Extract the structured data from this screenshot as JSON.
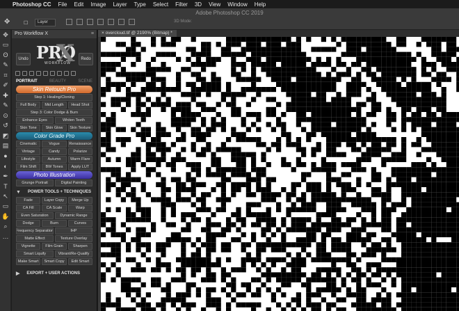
{
  "menubar": {
    "app": "Photoshop CC",
    "items": [
      "File",
      "Edit",
      "Image",
      "Layer",
      "Type",
      "Select",
      "Filter",
      "3D",
      "View",
      "Window",
      "Help"
    ]
  },
  "window": {
    "title": "Adobe Photoshop CC 2019"
  },
  "options": {
    "layer_select": "Layer",
    "mode_3d": "3D Mode:"
  },
  "panel": {
    "title": "Pro Workflow X",
    "undo": "Undo",
    "redo": "Redo",
    "logo_main": "PRO",
    "logo_x": "X",
    "logo_sub": "WORKFLOW",
    "tabs": [
      "PORTRAIT",
      "BEAUTY",
      "SCENE"
    ],
    "skin_header": "Skin Retouch Pro",
    "skin_rows": [
      [
        "Step 1: Healing/Cloning"
      ],
      [
        "Full Body",
        "Mid Length",
        "Head Shot"
      ],
      [
        "Step 3: Color Dodge & Burn"
      ],
      [
        "Enhance Eyes",
        "Whiten Teeth"
      ],
      [
        "Skin Tone",
        "Skin Glow",
        "Skin Texture"
      ]
    ],
    "color_header": "Color Grade Pro",
    "color_rows": [
      [
        "Cinematic",
        "Vogue",
        "Renaissance"
      ],
      [
        "Vintage",
        "Candy",
        "Polarize"
      ],
      [
        "Lifestyle",
        "Autumn",
        "Warm Flare"
      ],
      [
        "Film Shift",
        "BW Tones",
        "Apply LUT"
      ]
    ],
    "photo_header": "Photo Illustration",
    "photo_rows": [
      [
        "Grunge Portrait",
        "Digital Painting"
      ]
    ],
    "power_title": "POWER TOOLS + TECHNIQUES",
    "power_rows": [
      [
        "Fade",
        "Layer Copy",
        "Merge Up"
      ],
      [
        "CA Fill",
        "CA Scale",
        "Warp"
      ],
      [
        "Even Saturation",
        "Dynamic Range"
      ],
      [
        "Dodge",
        "Burn",
        "Curves"
      ],
      [
        "Frequency Separation",
        "IHP"
      ],
      [
        "Matte Effect",
        "Texture Overlay"
      ],
      [
        "Vignette",
        "Film Grain",
        "Sharpen"
      ],
      [
        "Smart Liquify",
        "Vibrant/Re-Qualify"
      ],
      [
        "Make Smart",
        "Smart Copy",
        "Edit Smart"
      ]
    ],
    "export_title": "EXPORT + USER ACTIONS"
  },
  "document": {
    "tab": "overcloud.tif @ 2190% (Bitmap) *"
  },
  "icons": {
    "tools": [
      "move-icon",
      "marquee-icon",
      "lasso-icon",
      "quick-select-icon",
      "crop-icon",
      "eyedropper-icon",
      "healing-icon",
      "brush-icon",
      "stamp-icon",
      "history-brush-icon",
      "eraser-icon",
      "gradient-icon",
      "blur-icon",
      "dodge-icon",
      "pen-icon",
      "type-icon",
      "path-select-icon",
      "shape-icon",
      "hand-icon",
      "zoom-icon",
      "more-icon"
    ],
    "toolbar_glyphs": [
      "✥",
      "▭",
      "ʘ",
      "✎",
      "⌗",
      "✐",
      "✚",
      "✎",
      "⊙",
      "↺",
      "◩",
      "▤",
      "●",
      "◐",
      "✒",
      "T",
      "↖",
      "▭",
      "✋",
      "⌕",
      "…"
    ]
  },
  "colors": {
    "accent_orange": "#e07a3a",
    "accent_teal": "#2a8cac",
    "accent_purple": "#5048c0"
  }
}
